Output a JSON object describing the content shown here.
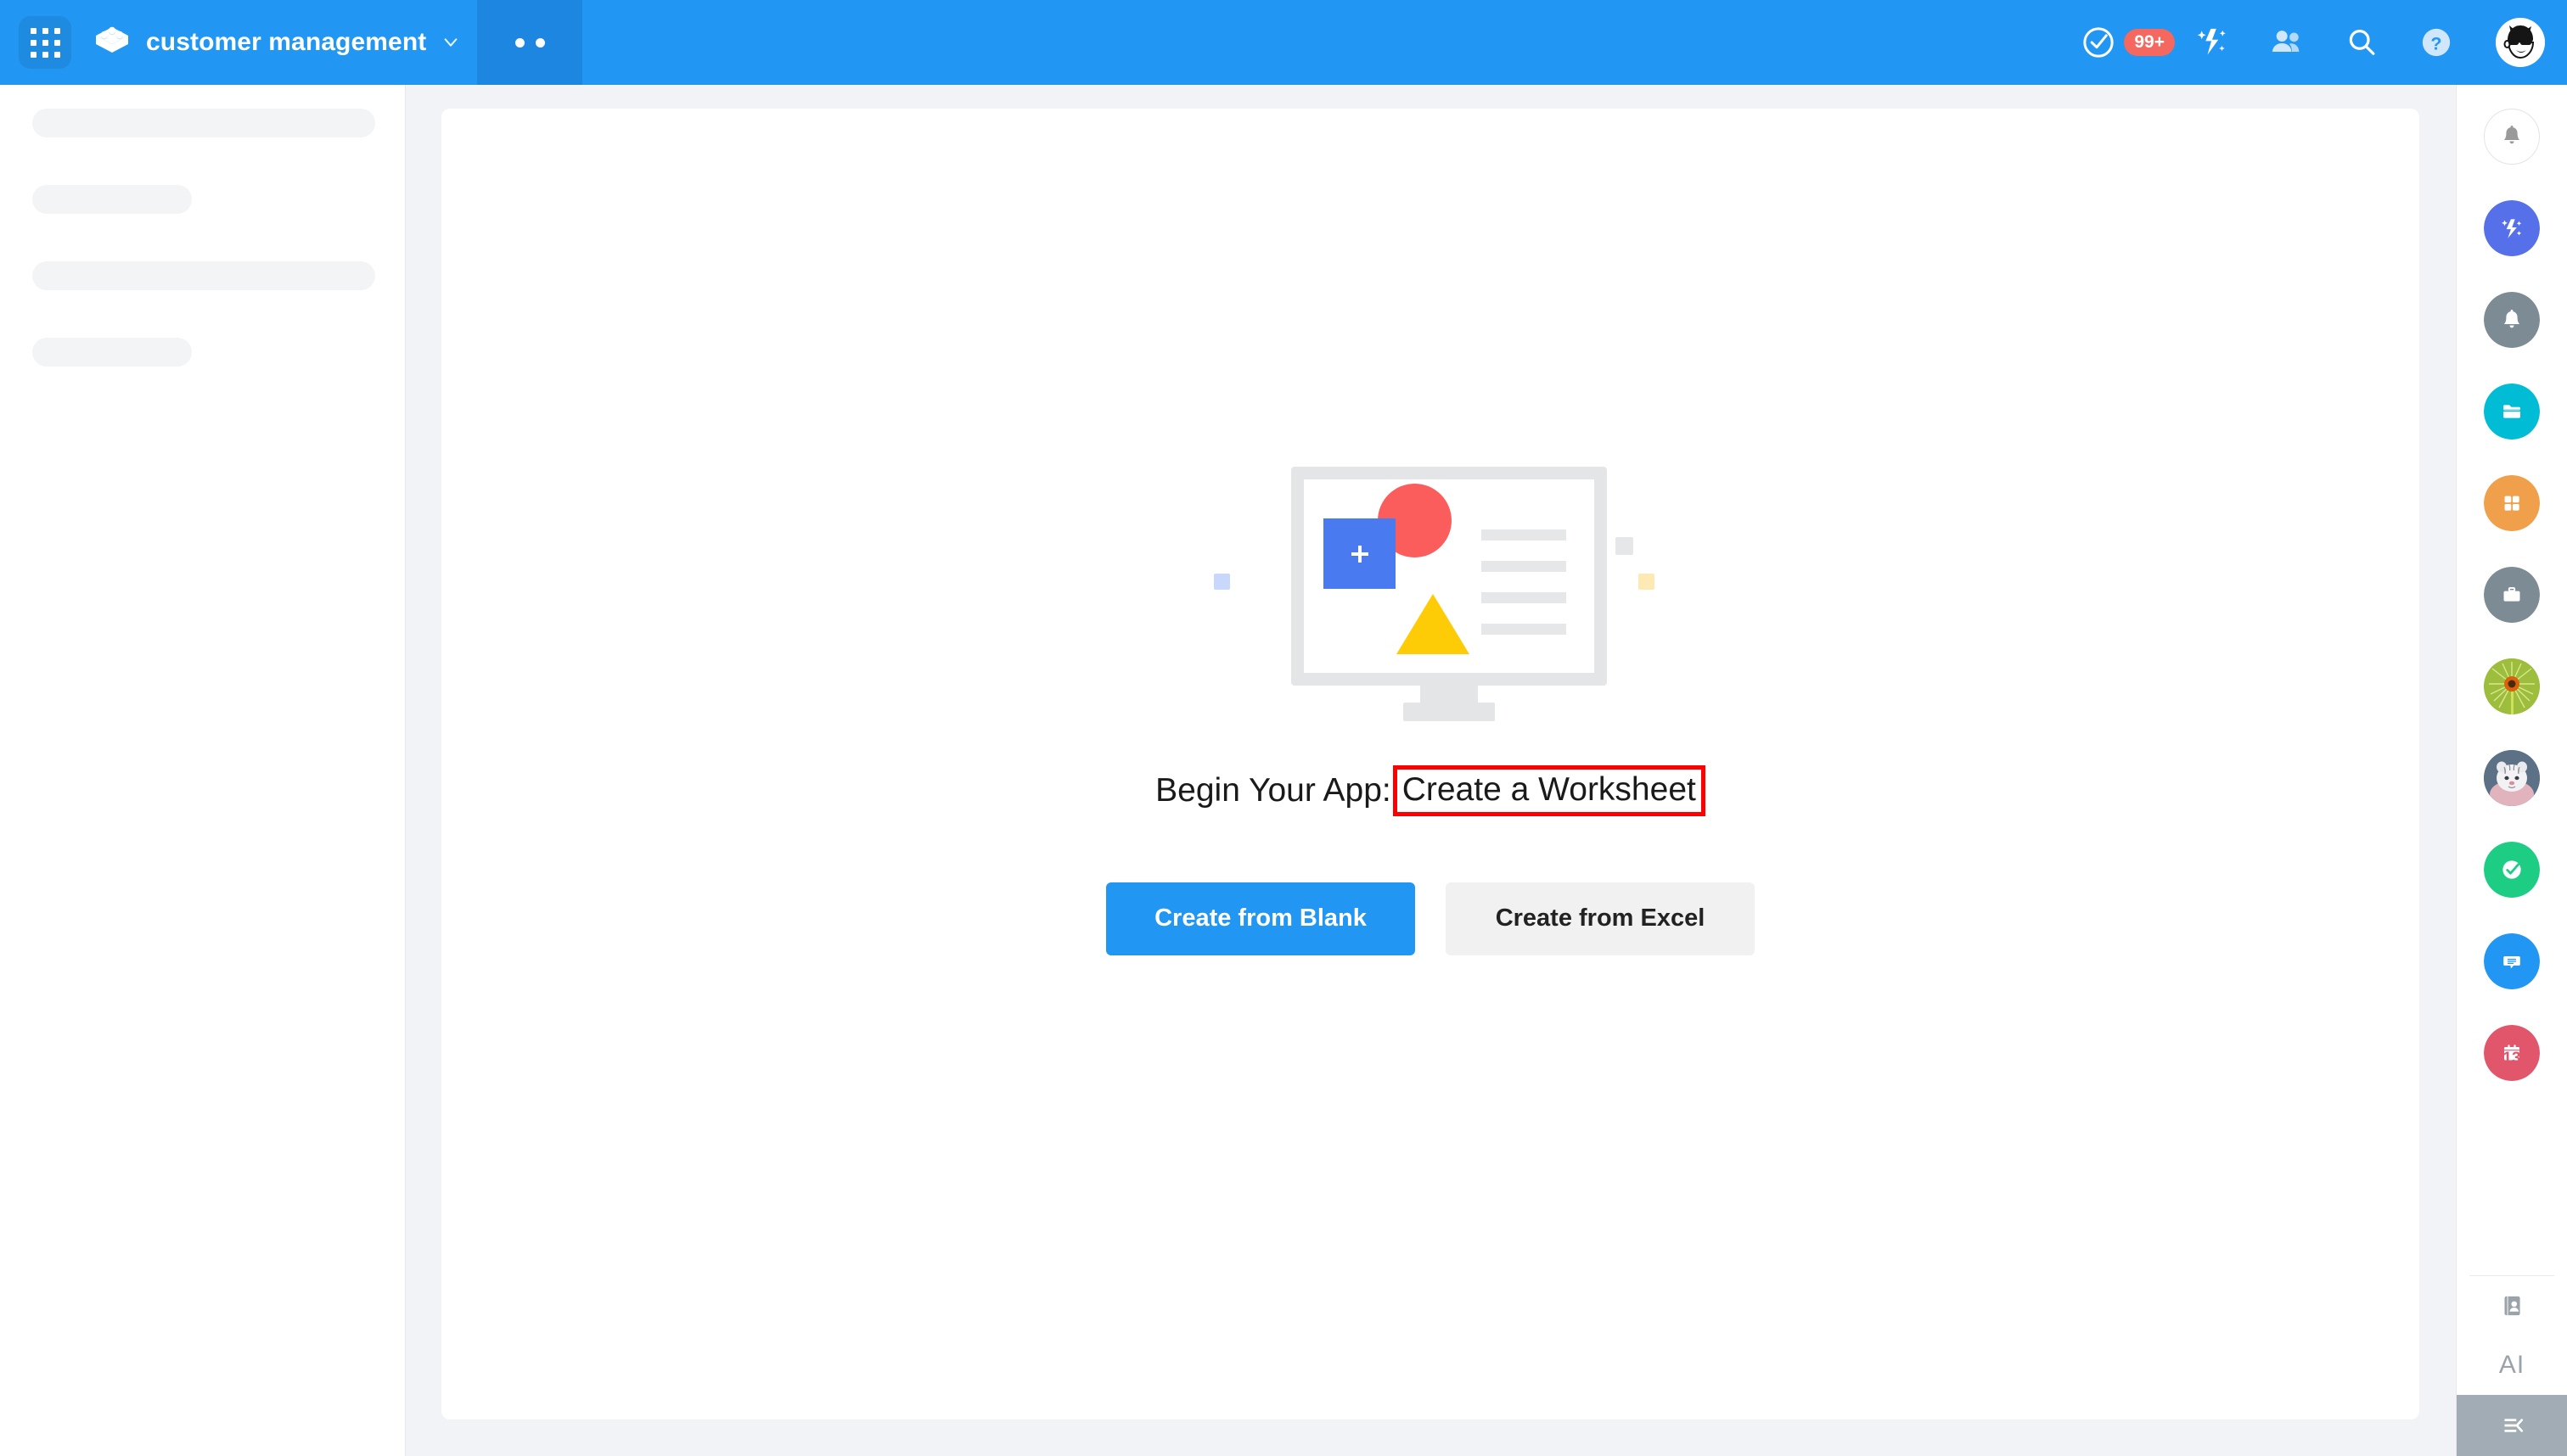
{
  "header": {
    "apps_grid_icon": "apps-grid-icon",
    "app_logo_icon": "brick-logo-icon",
    "app_title": "customer management",
    "title_chevron_icon": "chevron-down-icon",
    "tab_dots_label": "••",
    "right_icons": [
      {
        "name": "check-circle-icon",
        "badge": "99+"
      },
      {
        "name": "ai-sparkle-icon"
      },
      {
        "name": "people-icon"
      },
      {
        "name": "search-icon"
      },
      {
        "name": "help-icon"
      },
      {
        "name": "user-avatar"
      }
    ],
    "badge_text": "99+",
    "colors": {
      "bar": "#2196f3",
      "tab_active": "#1c86e0",
      "badge": "#f5685f"
    }
  },
  "left_sidebar": {
    "skeleton_items": [
      {
        "width": "long"
      },
      {
        "width": "short"
      },
      {
        "width": "long"
      },
      {
        "width": "short"
      }
    ]
  },
  "main": {
    "illustration": {
      "name": "empty-state-illustration",
      "shapes": [
        "monitor",
        "red-circle",
        "blue-square-plus",
        "yellow-triangle",
        "text-lines"
      ],
      "text_line_count": 4,
      "decor_squares": [
        "light-blue",
        "gray",
        "yellow"
      ]
    },
    "headline_prefix": "Begin Your App:",
    "headline_highlight": "Create a Worksheet",
    "highlight_color": "#fe0000",
    "buttons": [
      {
        "label": "Create from Blank",
        "style": "primary",
        "color": "#2196f3"
      },
      {
        "label": "Create from Excel",
        "style": "secondary",
        "color": "#f1f1f1"
      }
    ]
  },
  "right_sidebar": {
    "items": [
      {
        "name": "notification-bell-icon",
        "style": "outline",
        "color": "#ffffff"
      },
      {
        "name": "ai-sparkle-icon",
        "style": "filled",
        "color": "#5570e8"
      },
      {
        "name": "bell-icon",
        "style": "filled",
        "color": "#7d8b94"
      },
      {
        "name": "folder-icon",
        "style": "filled",
        "color": "#00bcd4"
      },
      {
        "name": "grid-apps-icon",
        "style": "filled",
        "color": "#f0a04b"
      },
      {
        "name": "briefcase-icon",
        "style": "filled",
        "color": "#7d8b94"
      },
      {
        "name": "dandelion-photo-avatar",
        "style": "photo",
        "color": "#8fae34"
      },
      {
        "name": "white-tiger-photo-avatar",
        "style": "photo",
        "color": "#6f7f91"
      },
      {
        "name": "check-circle-icon",
        "style": "filled",
        "color": "#1ecd84"
      },
      {
        "name": "chat-bubble-icon",
        "style": "filled",
        "color": "#2196f3"
      },
      {
        "name": "calendar-icon",
        "style": "filled",
        "color": "#e2566c",
        "day": "13"
      }
    ],
    "bottom": {
      "contacts_icon": "contacts-book-icon",
      "ai_label": "AI",
      "collapse_icon": "collapse-panel-icon",
      "collapse_bg": "#a2acb4"
    }
  }
}
